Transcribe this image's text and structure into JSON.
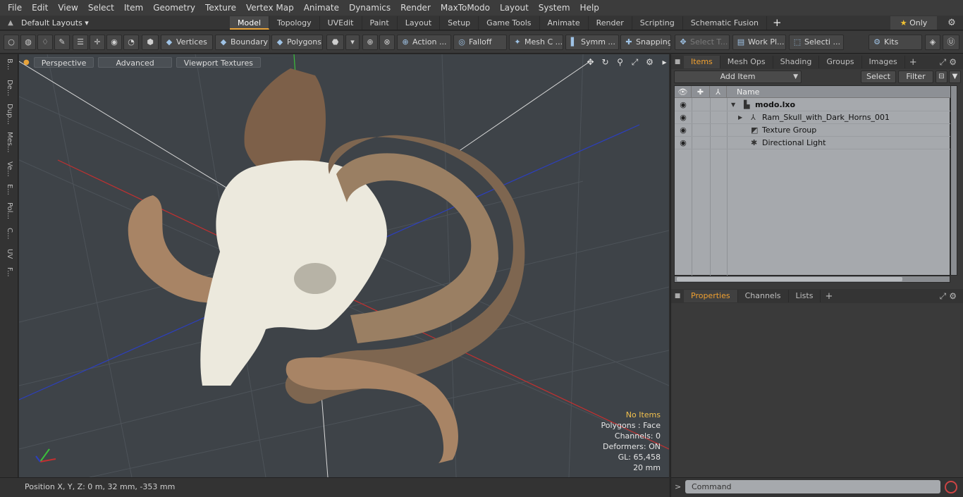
{
  "menubar": {
    "items": [
      "File",
      "Edit",
      "View",
      "Select",
      "Item",
      "Geometry",
      "Texture",
      "Vertex Map",
      "Animate",
      "Dynamics",
      "Render",
      "MaxToModo",
      "Layout",
      "System",
      "Help"
    ]
  },
  "layoutbar": {
    "default_layouts": "Default Layouts ▾",
    "tabs": [
      "Model",
      "Topology",
      "UVEdit",
      "Paint",
      "Layout",
      "Setup",
      "Game Tools",
      "Animate",
      "Render",
      "Scripting",
      "Schematic Fusion"
    ],
    "active_tab": "Model",
    "plus": "+",
    "only_label": "Only",
    "star": "★",
    "accent_color": "#e8a33a"
  },
  "toolbar": {
    "vertices": "Vertices",
    "boundary": "Boundary",
    "polygons": "Polygons",
    "action": "Action ...",
    "falloff": "Falloff",
    "mesh_c": "Mesh C ...",
    "symm": "Symm ...",
    "snapping": "Snapping",
    "select_t": "Select T...",
    "work_pl": "Work Pl...",
    "selecti": "Selecti ...",
    "kits": "Kits"
  },
  "left_tabs": [
    "B...",
    "De...",
    "Dup...",
    "Mes...",
    "Ve...",
    "E...",
    "Pol...",
    "C...",
    "UV",
    "F..."
  ],
  "viewport": {
    "perspective": "Perspective",
    "advanced": "Advanced",
    "viewport_textures": "Viewport Textures",
    "stats": {
      "items": "No Items",
      "polygons": "Polygons : Face",
      "channels": "Channels: 0",
      "deformers": "Deformers: ON",
      "gl": "GL: 65,458",
      "size": "20 mm"
    }
  },
  "statusbar": {
    "position": "Position X, Y, Z:   0 m, 32 mm, -353 mm"
  },
  "items_panel": {
    "tabs": [
      "Items",
      "Mesh Ops",
      "Shading",
      "Groups",
      "Images"
    ],
    "active_tab": "Items",
    "add_item": "Add Item",
    "select": "Select",
    "filter": "Filter",
    "name_header": "Name",
    "rows": [
      {
        "name": "modo.lxo"
      },
      {
        "name": "Ram_Skull_with_Dark_Horns_001"
      },
      {
        "name": "Texture Group"
      },
      {
        "name": "Directional Light"
      }
    ]
  },
  "properties_panel": {
    "tabs": [
      "Properties",
      "Channels",
      "Lists"
    ],
    "active_tab": "Properties"
  },
  "command": {
    "placeholder": "Command"
  }
}
